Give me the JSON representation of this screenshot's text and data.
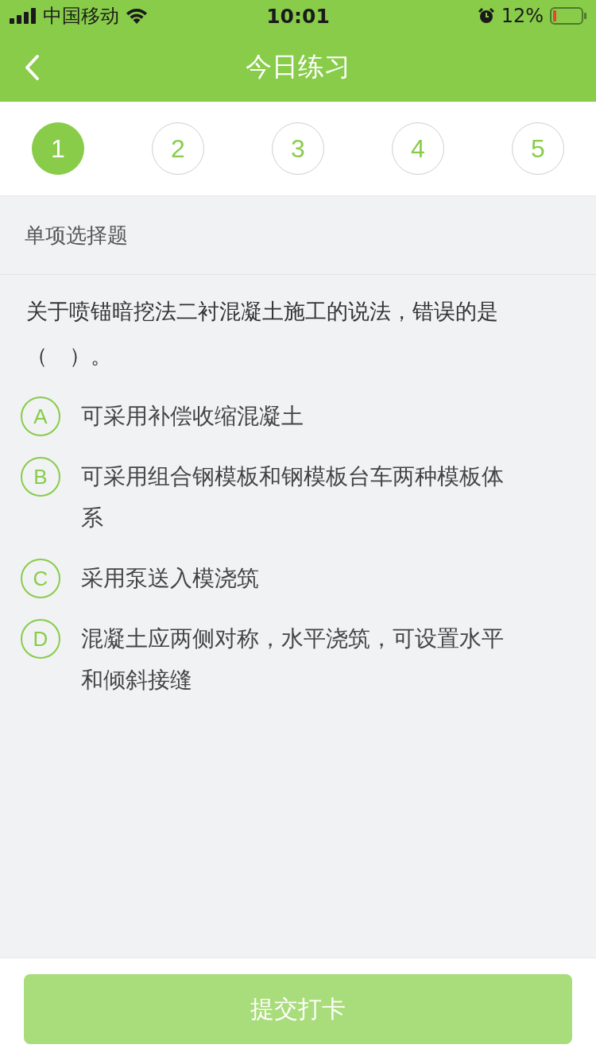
{
  "status_bar": {
    "carrier": "中国移动",
    "time": "10:01",
    "battery": "12%"
  },
  "nav": {
    "title": "今日练习"
  },
  "question_numbers": [
    {
      "label": "1",
      "selected": true
    },
    {
      "label": "2",
      "selected": false
    },
    {
      "label": "3",
      "selected": false
    },
    {
      "label": "4",
      "selected": false
    },
    {
      "label": "5",
      "selected": false
    }
  ],
  "section": "单项选择题",
  "question": "关于喷锚暗挖法二衬混凝土施工的说法，错误的是（　）。",
  "options": [
    {
      "letter": "A",
      "text": "可采用补偿收缩混凝土",
      "selected": false
    },
    {
      "letter": "B",
      "text": "可采用组合钢模板和钢模板台车两种模板体系",
      "selected": false
    },
    {
      "letter": "C",
      "text": "采用泵送入模浇筑",
      "selected": false
    },
    {
      "letter": "D",
      "text": "混凝土应两侧对称，水平浇筑，可设置水平和倾斜接缝",
      "selected": false
    }
  ],
  "submit": "提交打卡"
}
